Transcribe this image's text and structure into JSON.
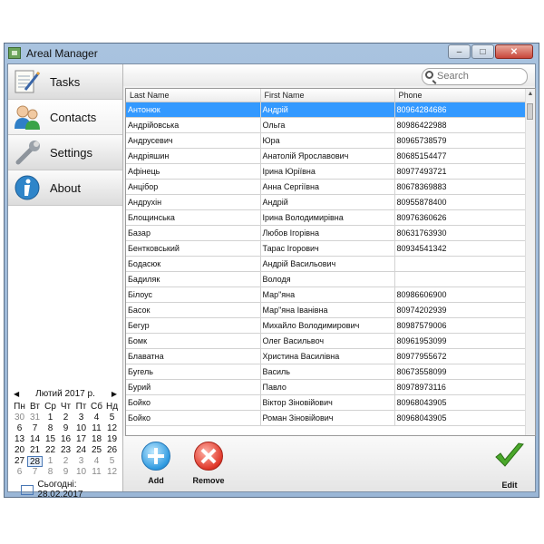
{
  "window": {
    "title": "Areal Manager",
    "controls": {
      "minimize": "–",
      "maximize": "□",
      "close": "✕"
    }
  },
  "sidebar": {
    "items": [
      {
        "label": "Tasks",
        "icon": "notepad-pencil-icon"
      },
      {
        "label": "Contacts",
        "icon": "people-icon"
      },
      {
        "label": "Settings",
        "icon": "wrench-icon"
      },
      {
        "label": "About",
        "icon": "info-icon"
      }
    ]
  },
  "calendar": {
    "month_label": "Лютий 2017 р.",
    "prev": "◀",
    "next": "▶",
    "weekdays": [
      "Пн",
      "Вт",
      "Ср",
      "Чт",
      "Пт",
      "Сб",
      "Нд"
    ],
    "weeks": [
      [
        "30",
        "31",
        "1",
        "2",
        "3",
        "4",
        "5"
      ],
      [
        "6",
        "7",
        "8",
        "9",
        "10",
        "11",
        "12"
      ],
      [
        "13",
        "14",
        "15",
        "16",
        "17",
        "18",
        "19"
      ],
      [
        "20",
        "21",
        "22",
        "23",
        "24",
        "25",
        "26"
      ],
      [
        "27",
        "28",
        "1",
        "2",
        "3",
        "4",
        "5"
      ],
      [
        "6",
        "7",
        "8",
        "9",
        "10",
        "11",
        "12"
      ]
    ],
    "today_label": "Сьогодні: 28.02.2017"
  },
  "search": {
    "placeholder": "Search"
  },
  "table": {
    "columns": [
      "Last Name",
      "First Name",
      "Phone"
    ],
    "selected_index": 0,
    "rows": [
      [
        "Антонюк",
        "Андрій",
        "80964284686"
      ],
      [
        "Андрійовська",
        "Ольга",
        "80986422988"
      ],
      [
        "Андрусевич",
        "Юра",
        "80965738579"
      ],
      [
        "Андріяшин",
        "Анатолій Ярославович",
        "80685154477"
      ],
      [
        "Афінець",
        "Ірина Юріївна",
        "80977493721"
      ],
      [
        "Анцібор",
        "Анна Сергіївна",
        "80678369883"
      ],
      [
        "Андрухін",
        "Андрій",
        "80955878400"
      ],
      [
        "Блощинська",
        "Ірина Володимирівна",
        "80976360626"
      ],
      [
        "Базар",
        "Любов Ігорівна",
        "80631763930"
      ],
      [
        "Бентковський",
        "Тарас Ігорович",
        "80934541342"
      ],
      [
        "Бодасюк",
        "Андрій Васильович",
        ""
      ],
      [
        "Бадиляк",
        "Володя",
        ""
      ],
      [
        "Білоус",
        "Мар\"яна",
        "80986606900"
      ],
      [
        "Басок",
        "Мар\"яна Іванівна",
        "80974202939"
      ],
      [
        "Бегур",
        "Михайло Володимирович",
        "80987579006"
      ],
      [
        "Бомк",
        "Олег Васильвоч",
        "80961953099"
      ],
      [
        "Блаватна",
        "Христина Василівна",
        "80977955672"
      ],
      [
        "Бугель",
        "Василь",
        "80673558099"
      ],
      [
        "Бурий",
        "Павло",
        "80978973116"
      ],
      [
        "Бойко",
        "Віктор Зіновійович",
        "80968043905"
      ],
      [
        "Бойко",
        "Роман Зіновійович",
        "80968043905"
      ]
    ]
  },
  "toolbar": {
    "add_label": "Add",
    "remove_label": "Remove",
    "edit_label": "Edit"
  }
}
